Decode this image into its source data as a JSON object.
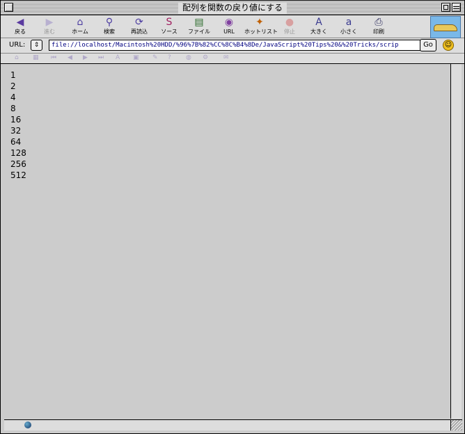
{
  "window": {
    "title": "配列を関数の戻り値にする"
  },
  "toolbar": {
    "buttons": [
      {
        "label": "戻る",
        "icon": "back-arrow-icon",
        "glyph": "◀",
        "color": "#5a3aa0"
      },
      {
        "label": "進む",
        "icon": "forward-arrow-icon",
        "glyph": "▶",
        "color": "#b8b0d0"
      },
      {
        "label": "ホーム",
        "icon": "home-icon",
        "glyph": "⌂",
        "color": "#4a3aa0"
      },
      {
        "label": "検索",
        "icon": "search-icon",
        "glyph": "⚲",
        "color": "#4a3aa0"
      },
      {
        "label": "再読込",
        "icon": "reload-icon",
        "glyph": "⟳",
        "color": "#4a3aa0"
      },
      {
        "label": "ソース",
        "icon": "source-icon",
        "glyph": "S",
        "color": "#a02060"
      },
      {
        "label": "ファイル",
        "icon": "file-icon",
        "glyph": "▤",
        "color": "#2a6a2a"
      },
      {
        "label": "URL",
        "icon": "url-icon",
        "glyph": "◉",
        "color": "#8040a0"
      },
      {
        "label": "ホットリスト",
        "icon": "hotlist-icon",
        "glyph": "✦",
        "color": "#c06000"
      },
      {
        "label": "停止",
        "icon": "stop-icon",
        "glyph": "●",
        "color": "#d8a0a0"
      },
      {
        "label": "大きく",
        "icon": "larger-text-icon",
        "glyph": "A",
        "color": "#3a3a90"
      },
      {
        "label": "小さく",
        "icon": "smaller-text-icon",
        "glyph": "a",
        "color": "#3a3a90"
      },
      {
        "label": "印刷",
        "icon": "print-icon",
        "glyph": "⎙",
        "color": "#303060"
      }
    ]
  },
  "address": {
    "label": "URL:",
    "url": "file://localhost/Macintosh%20HDD/%96%7B%82%CC%8C%B4%8De/JavaScript%20Tips%20&%20Tricks/scrip",
    "go_label": "Go"
  },
  "favorites": {
    "icons": [
      "home-icon",
      "bookmark-icon",
      "first-icon",
      "prev-icon",
      "next-icon",
      "last-icon",
      "font-icon",
      "image-icon",
      "edit-icon",
      "help-icon",
      "web-icon",
      "settings-icon",
      "mail-icon"
    ]
  },
  "content": {
    "lines": [
      "1",
      "2",
      "4",
      "8",
      "16",
      "32",
      "64",
      "128",
      "256",
      "512"
    ]
  },
  "colors": {
    "background": "#cccccc",
    "chrome": "#dddddd",
    "url_text": "#000080"
  }
}
